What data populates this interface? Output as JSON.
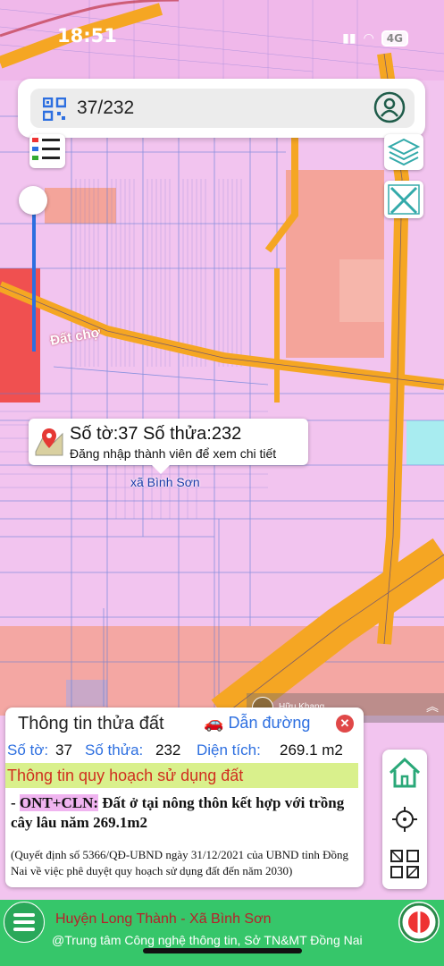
{
  "status_bar": {
    "time": "18:51",
    "network": "4G"
  },
  "search": {
    "value": "37/232"
  },
  "map": {
    "market_label": "Đất chợ",
    "commune_label": "xã Bình Sơn"
  },
  "popup": {
    "title": "Số tờ:37 Số thửa:232",
    "subtitle": "Đăng nhập thành viên để xem chi tiết"
  },
  "watermark": {
    "name": "Hữu Khang"
  },
  "info_panel": {
    "title": "Thông tin thửa đất",
    "directions_label": "Dẫn đường",
    "sheet_label": "Số tờ:",
    "sheet_value": "37",
    "parcel_label": "Số thửa:",
    "parcel_value": "232",
    "area_label": "Diện tích:",
    "area_value": "269.1 m2",
    "plan_header": "Thông tin quy hoạch sử dụng đất",
    "plan_code": "ONT+CLN:",
    "plan_desc": "Đất ở tại nông thôn kết hợp với trồng cây lâu năm 269.1m2",
    "plan_note": "(Quyết định số 5366/QĐ-UBND ngày 31/12/2021 của UBND tỉnh Đồng Nai về việc phê duyệt quy hoạch sử dụng đất đến năm 2030)"
  },
  "bottom_bar": {
    "title": "Huyện Long Thành - Xã Bình Sơn",
    "subtitle": "@Trung tâm Công nghệ thông tin, Sở TN&MT Đồng Nai"
  },
  "colors": {
    "map_residential": "#f2c4ef",
    "map_road": "#f5a623",
    "map_commercial": "#f4a49a",
    "accent_blue": "#2d6fe0",
    "bottom_green": "#36c66a",
    "plan_highlight": "#d9f08c"
  },
  "icons": [
    "qr-code-icon",
    "user-icon",
    "legend-icon",
    "layers-icon",
    "measure-icon",
    "pin-icon",
    "car-icon",
    "close-icon",
    "home-icon",
    "locate-icon",
    "grid-icon",
    "menu-icon",
    "logo-icon"
  ]
}
